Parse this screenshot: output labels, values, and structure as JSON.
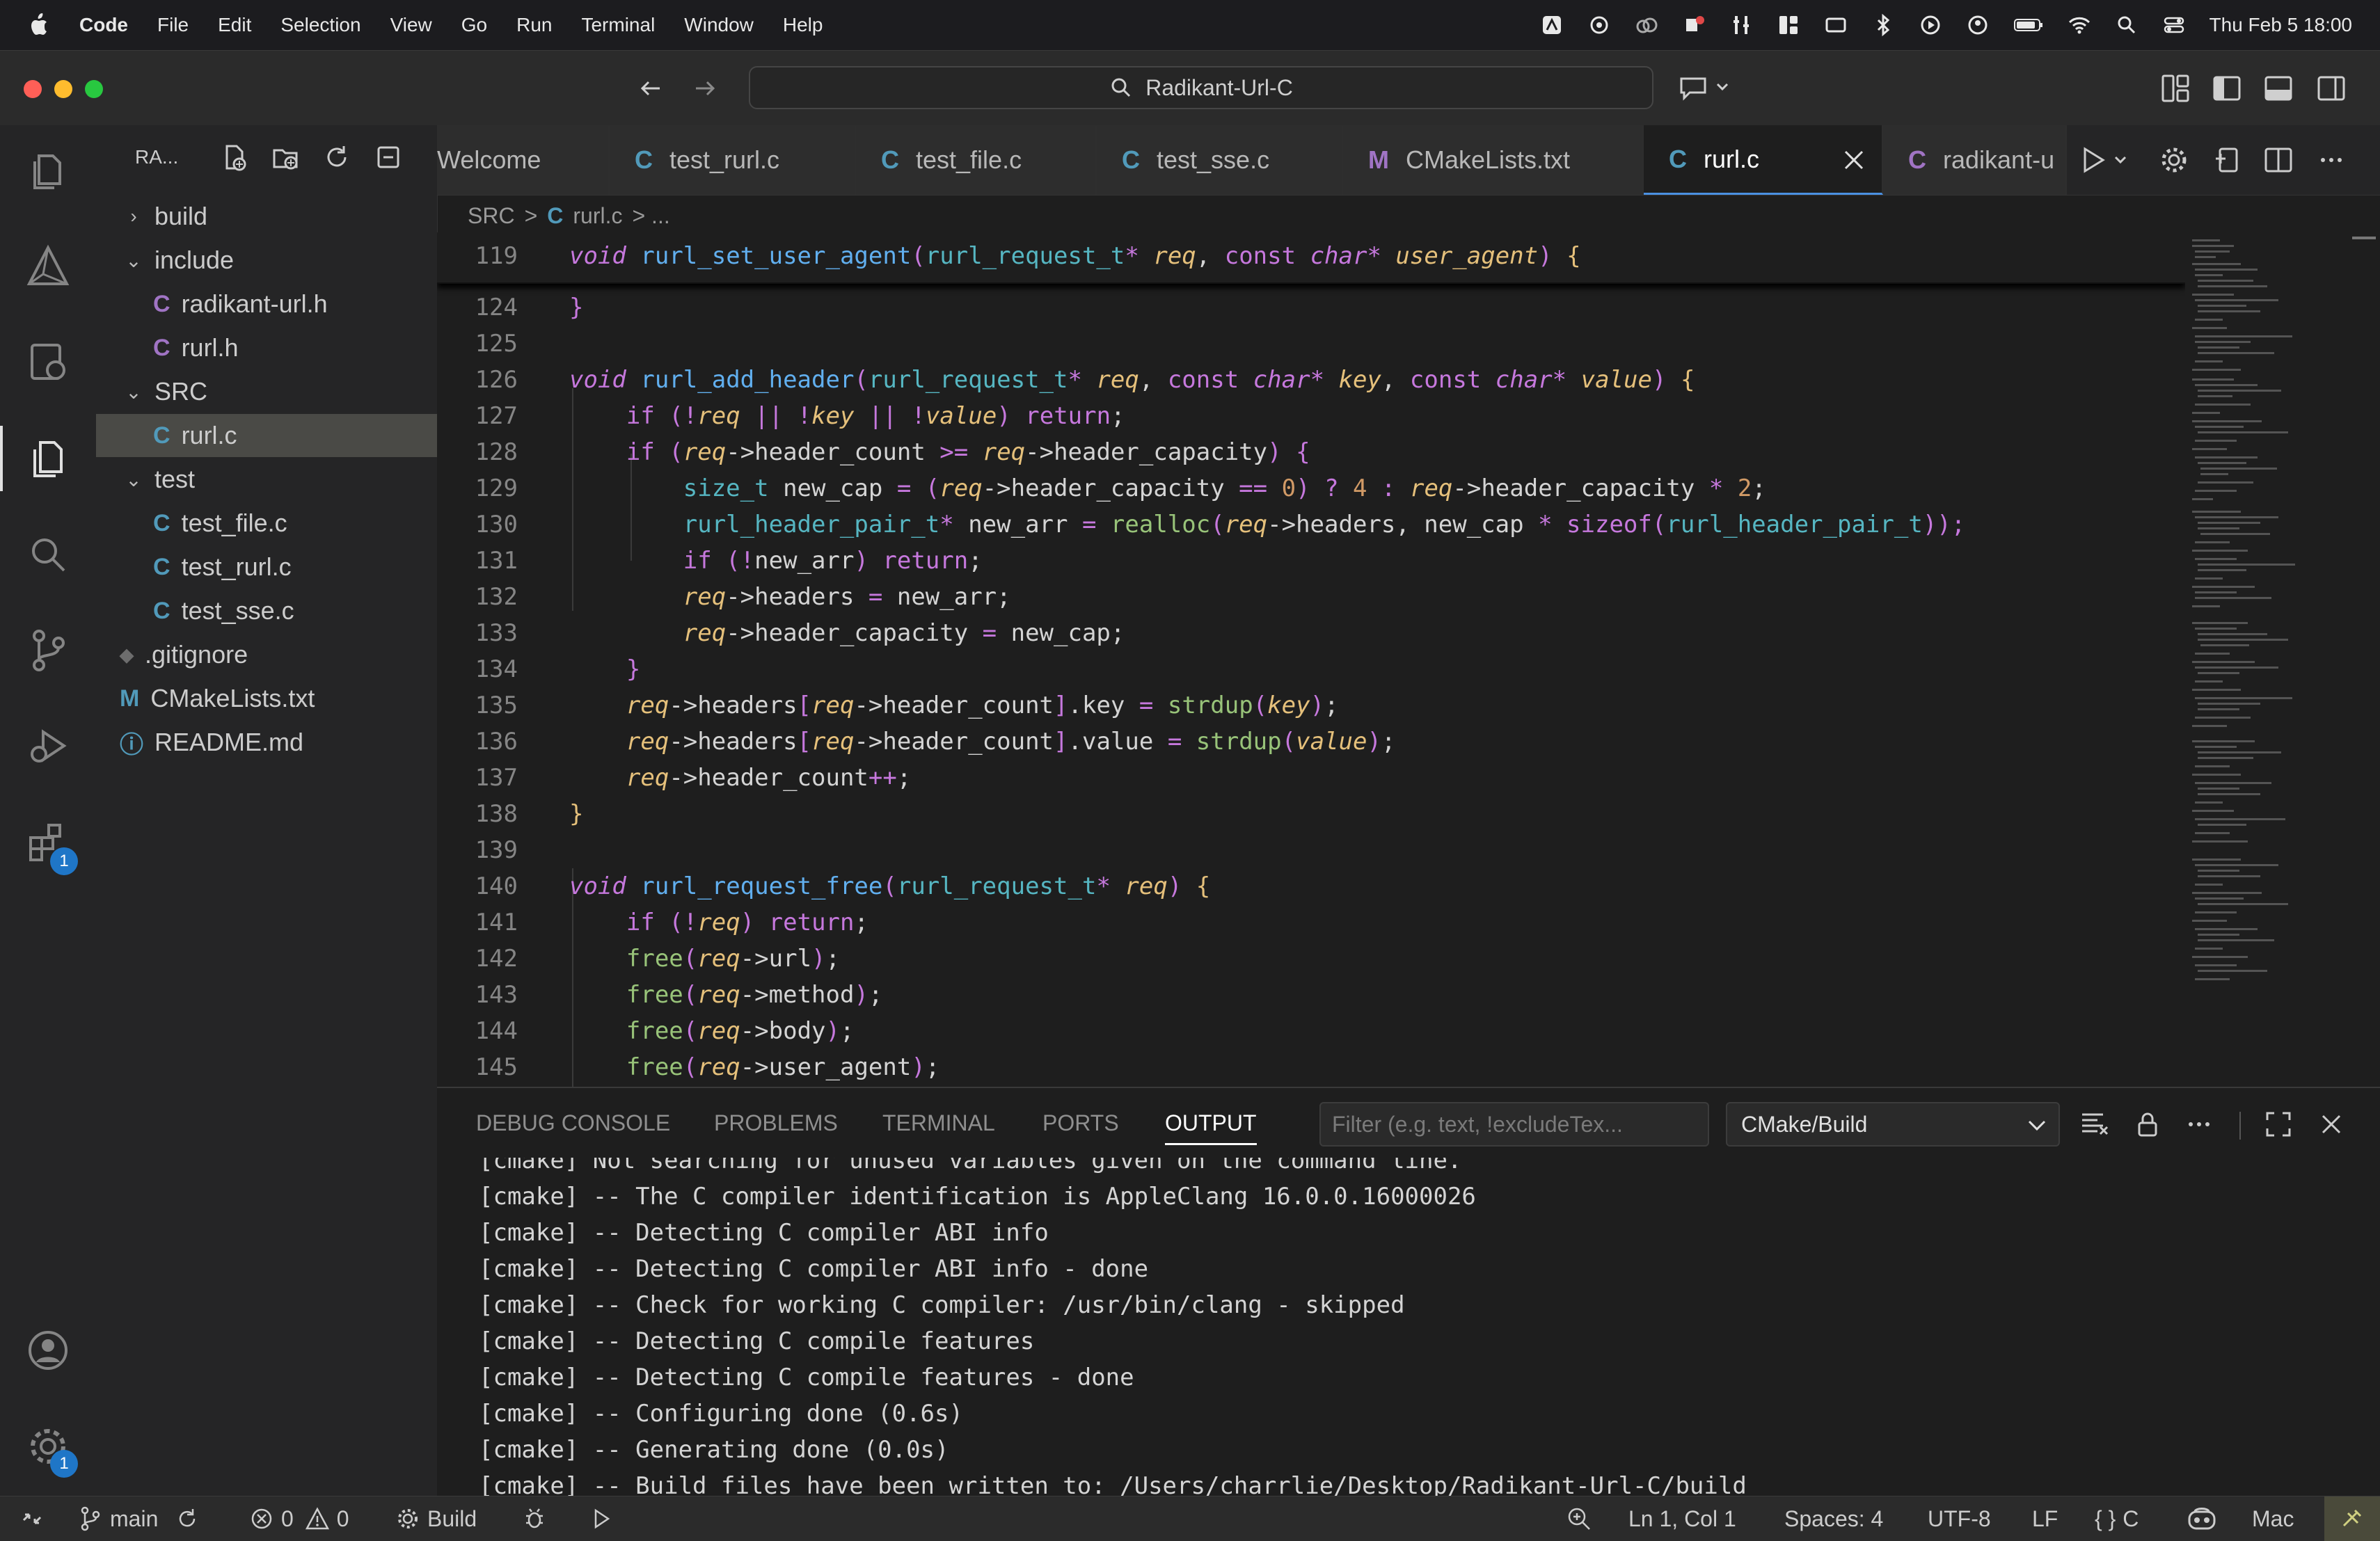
{
  "menubar": {
    "app": "Code",
    "items": [
      "File",
      "Edit",
      "Selection",
      "View",
      "Go",
      "Run",
      "Terminal",
      "Window",
      "Help"
    ],
    "datetime": "Thu Feb 5  18:00"
  },
  "titlebar": {
    "search_text": "Radikant-Url-C"
  },
  "activity": {
    "extensions_badge": "1",
    "settings_badge": "1"
  },
  "explorer": {
    "title": "RA...",
    "tree": [
      {
        "label": "build",
        "icon": "",
        "type": "folder-collapsed"
      },
      {
        "label": "include",
        "icon": "",
        "type": "folder-open"
      },
      {
        "label": "radikant-url.h",
        "icon": "C",
        "type": "file"
      },
      {
        "label": "rurl.h",
        "icon": "C",
        "type": "file"
      },
      {
        "label": "SRC",
        "icon": "",
        "type": "folder-open"
      },
      {
        "label": "rurl.c",
        "icon": "C",
        "type": "file-selected"
      },
      {
        "label": "test",
        "icon": "",
        "type": "folder-open"
      },
      {
        "label": "test_file.c",
        "icon": "C",
        "type": "file"
      },
      {
        "label": "test_rurl.c",
        "icon": "C",
        "type": "file"
      },
      {
        "label": "test_sse.c",
        "icon": "C",
        "type": "file"
      },
      {
        "label": ".gitignore",
        "icon": "◆",
        "type": "file"
      },
      {
        "label": "CMakeLists.txt",
        "icon": "M",
        "type": "file"
      },
      {
        "label": "README.md",
        "icon": "ⓘ",
        "type": "file"
      }
    ]
  },
  "tabs": [
    {
      "label": "Welcome",
      "icon": ""
    },
    {
      "label": "test_rurl.c",
      "icon": "C"
    },
    {
      "label": "test_file.c",
      "icon": "C"
    },
    {
      "label": "test_sse.c",
      "icon": "C"
    },
    {
      "label": "CMakeLists.txt",
      "icon": "M"
    },
    {
      "label": "rurl.c",
      "icon": "C"
    },
    {
      "label": "radikant-u",
      "icon": "C"
    }
  ],
  "breadcrumbs": {
    "a": "SRC",
    "sep": ">",
    "b": "rurl.c",
    "c": "> ..."
  },
  "editor": {
    "sticky_line": "119",
    "line_numbers": [
      "124",
      "125",
      "126",
      "127",
      "128",
      "129",
      "130",
      "131",
      "132",
      "133",
      "134",
      "135",
      "136",
      "137",
      "138",
      "139",
      "140",
      "141",
      "142",
      "143",
      "144",
      "145"
    ]
  },
  "panel": {
    "tabs": [
      "DEBUG CONSOLE",
      "PROBLEMS",
      "TERMINAL",
      "PORTS",
      "OUTPUT"
    ],
    "filter_placeholder": "Filter (e.g. text, !excludeTex...",
    "channel": "CMake/Build",
    "output_lines": [
      "[cmake] Not searching for unused variables given on the command line.",
      "[cmake] -- The C compiler identification is AppleClang 16.0.0.16000026",
      "[cmake] -- Detecting C compiler ABI info",
      "[cmake] -- Detecting C compiler ABI info - done",
      "[cmake] -- Check for working C compiler: /usr/bin/clang - skipped",
      "[cmake] -- Detecting C compile features",
      "[cmake] -- Detecting C compile features - done",
      "[cmake] -- Configuring done (0.6s)",
      "[cmake] -- Generating done (0.0s)",
      "[cmake] -- Build files have been written to: /Users/charrlie/Desktop/Radikant-Url-C/build"
    ]
  },
  "status": {
    "branch": "main",
    "errors": "0",
    "warnings": "0",
    "build": "Build",
    "position": "Ln 1, Col 1",
    "spaces": "Spaces: 4",
    "encoding": "UTF-8",
    "eol": "LF",
    "lang_braces": "{ }",
    "lang": "C",
    "platform": "Mac"
  },
  "colors": {
    "accent": "#4a90e2",
    "badge": "#1f76c7",
    "keyword": "#c678dd",
    "function": "#61afef",
    "param": "#e5c07b",
    "type": "#56b6c2",
    "number": "#d19a66",
    "builtin": "#98c379"
  }
}
